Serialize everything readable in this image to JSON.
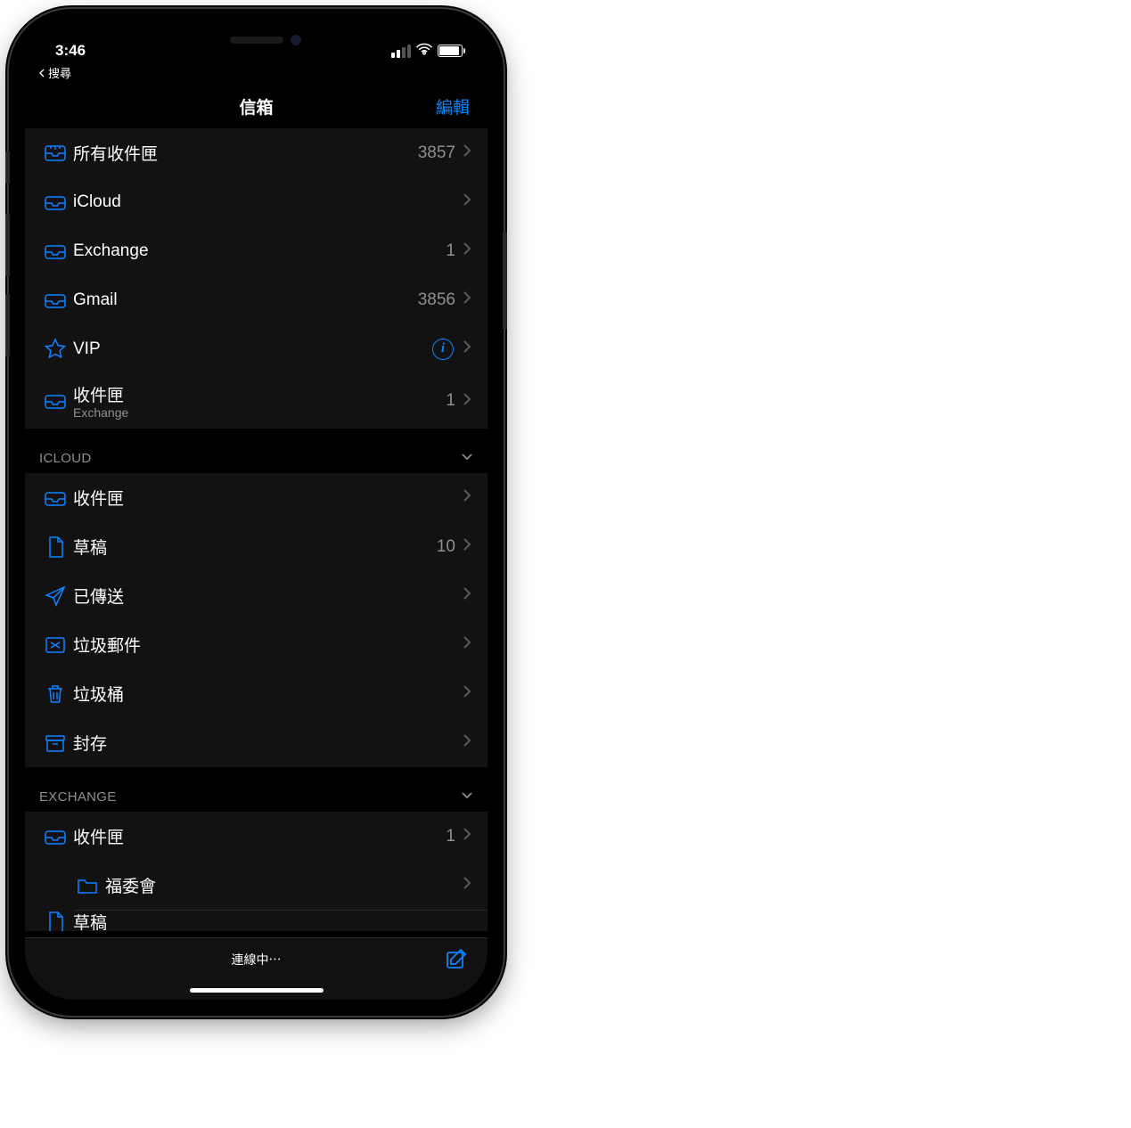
{
  "status": {
    "time": "3:46",
    "back_label": "搜尋"
  },
  "nav": {
    "title": "信箱",
    "edit": "編輯"
  },
  "mailboxes": [
    {
      "icon": "all-inbox",
      "label": "所有收件匣",
      "count": "3857"
    },
    {
      "icon": "inbox",
      "label": "iCloud",
      "count": ""
    },
    {
      "icon": "inbox",
      "label": "Exchange",
      "count": "1"
    },
    {
      "icon": "inbox",
      "label": "Gmail",
      "count": "3856"
    },
    {
      "icon": "star",
      "label": "VIP",
      "info": true
    },
    {
      "icon": "inbox",
      "label": "收件匣",
      "sub": "Exchange",
      "count": "1"
    }
  ],
  "sections": [
    {
      "title": "ICLOUD",
      "rows": [
        {
          "icon": "inbox",
          "label": "收件匣",
          "count": ""
        },
        {
          "icon": "doc",
          "label": "草稿",
          "count": "10"
        },
        {
          "icon": "sent",
          "label": "已傳送",
          "count": ""
        },
        {
          "icon": "junk",
          "label": "垃圾郵件",
          "count": ""
        },
        {
          "icon": "trash",
          "label": "垃圾桶",
          "count": ""
        },
        {
          "icon": "archive",
          "label": "封存",
          "count": ""
        }
      ]
    },
    {
      "title": "EXCHANGE",
      "rows": [
        {
          "icon": "inbox",
          "label": "收件匣",
          "count": "1"
        },
        {
          "icon": "folder",
          "label": "福委會",
          "count": "",
          "indent": true
        },
        {
          "icon": "doc",
          "label": "草稿",
          "count": "",
          "partial": true
        }
      ]
    }
  ],
  "toolbar": {
    "status": "連線中⋯"
  }
}
